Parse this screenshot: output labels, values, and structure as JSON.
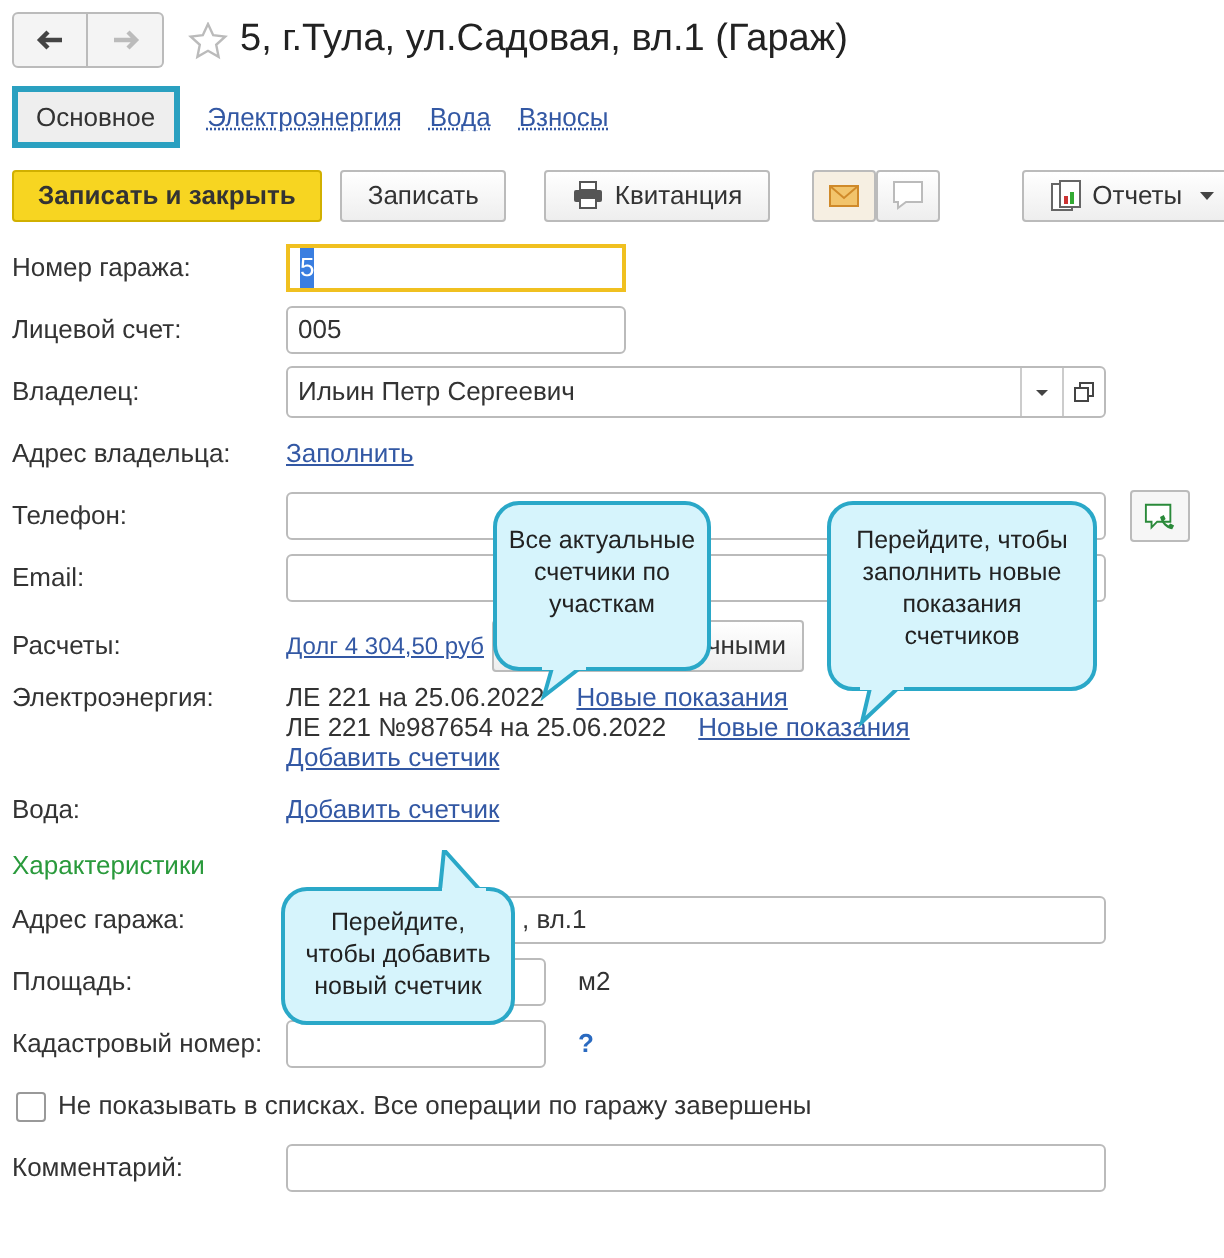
{
  "window": {
    "title": "5, г.Тула, ул.Садовая, вл.1 (Гараж)",
    "favorite": false
  },
  "nav": [
    {
      "kind": "back",
      "disabled": false
    },
    {
      "kind": "forward",
      "disabled": true
    }
  ],
  "tabs": [
    {
      "label": "Основное",
      "selected": true
    },
    {
      "label": "Электроэнергия",
      "selected": false
    },
    {
      "label": "Вода",
      "selected": false
    },
    {
      "label": "Взносы",
      "selected": false
    }
  ],
  "toolbar": [
    {
      "kind": "primary",
      "label": "Записать и закрыть"
    },
    {
      "kind": "plain",
      "label": "Записать"
    },
    {
      "kind": "print",
      "label": "Квитанция"
    },
    {
      "kind": "mail"
    },
    {
      "kind": "comment"
    },
    {
      "kind": "reports",
      "label": "Отчеты"
    }
  ],
  "rows": [
    {
      "kind": "input",
      "label": "Номер гаража:",
      "value": "5",
      "focused": true
    },
    {
      "kind": "input",
      "label": "Лицевой счет:",
      "value": "005",
      "focused": false
    },
    {
      "kind": "select",
      "label": "Владелец:",
      "value": "Ильин Петр Сергеевич"
    },
    {
      "kind": "link",
      "label": "Адрес владельца:",
      "link": "Заполнить"
    },
    {
      "kind": "phone",
      "label": "Телефон:"
    },
    {
      "kind": "wide_input",
      "label": "Email:"
    },
    {
      "kind": "settlements",
      "label": "Расчеты:",
      "link": "Долг 4 304,50 руб",
      "button": "чными"
    },
    {
      "kind": "meters",
      "label": "Электроэнергия:",
      "readings": [
        {
          "text": "ЛЕ 221 на 25.06.2022",
          "link": "Новые показания"
        },
        {
          "text": "ЛЕ 221 №987654 на 25.06.2022",
          "link": "Новые показания"
        }
      ],
      "add": "Добавить счетчик"
    },
    {
      "kind": "meters",
      "label": "Вода:",
      "readings": [],
      "add": "Добавить счетчик"
    },
    {
      "kind": "section",
      "label": "Характеристики"
    },
    {
      "kind": "wide_input",
      "label": "Адрес гаража:",
      "value": ", вл.1"
    },
    {
      "kind": "area",
      "label": "Площадь:",
      "unit": "м2"
    },
    {
      "kind": "cadastral",
      "label": "Кадастровый номер:",
      "help": "?"
    },
    {
      "kind": "checkbox",
      "label": "Не показывать в списках. Все операции по гаражу завершены",
      "checked": false
    },
    {
      "kind": "wide_input",
      "label": "Комментарий:"
    }
  ],
  "callouts": [
    {
      "text": "Все актуальные счетчики по участкам"
    },
    {
      "text": "Перейдите, чтобы заполнить новые показания счетчиков"
    },
    {
      "text": "Перейдите, чтобы добавить новый счетчик"
    }
  ]
}
